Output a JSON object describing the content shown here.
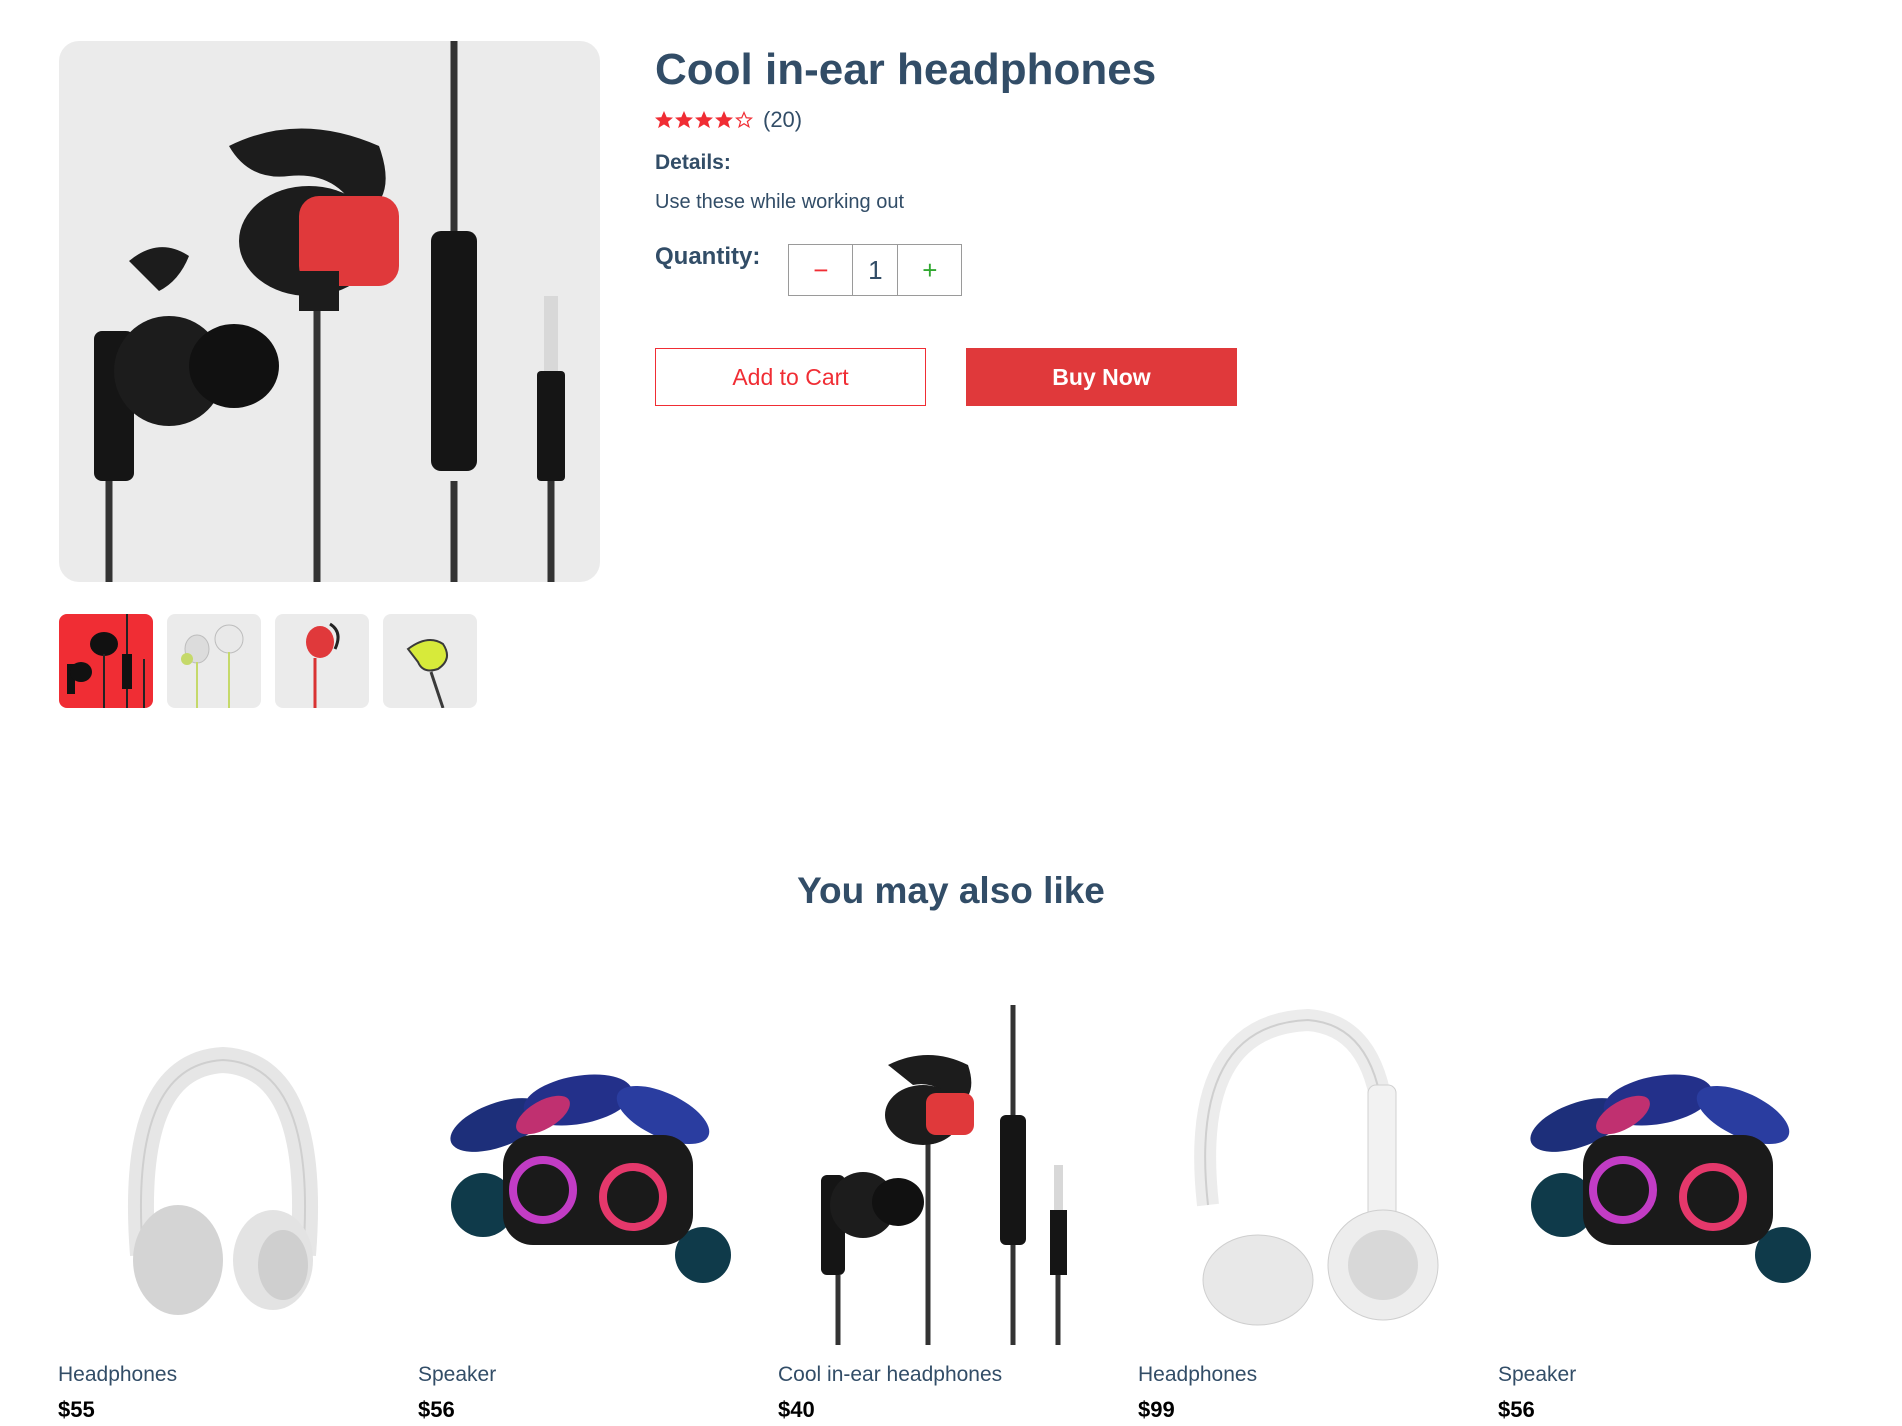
{
  "product": {
    "title": "Cool in-ear headphones",
    "rating": 4,
    "rating_max": 5,
    "review_count": "(20)",
    "details_heading": "Details:",
    "details_text": "Use these while working out",
    "quantity_label": "Quantity:",
    "quantity_value": "1",
    "minus_symbol": "−",
    "plus_symbol": "+",
    "add_to_cart_label": "Add to Cart",
    "buy_now_label": "Buy Now"
  },
  "gallery": {
    "thumbnails": [
      {
        "icon": "red-earphones-thumbnail",
        "selected": true
      },
      {
        "icon": "lime-earphones-thumbnail",
        "selected": false
      },
      {
        "icon": "red-single-earphone-thumbnail",
        "selected": false
      },
      {
        "icon": "yellow-earphone-thumbnail",
        "selected": false
      }
    ]
  },
  "recommendations": {
    "title": "You may also like",
    "items": [
      {
        "name": "Headphones",
        "price": "$55",
        "icon": "white-over-ear-headphones-image"
      },
      {
        "name": "Speaker",
        "price": "$56",
        "icon": "party-speaker-image"
      },
      {
        "name": "Cool in-ear headphones",
        "price": "$40",
        "icon": "in-ear-headphones-image"
      },
      {
        "name": "Headphones",
        "price": "$99",
        "icon": "white-on-ear-headphones-image"
      },
      {
        "name": "Speaker",
        "price": "$56",
        "icon": "party-speaker-image"
      }
    ]
  },
  "colors": {
    "primary_text": "#324d67",
    "accent_red": "#f02d34",
    "buy_red": "#e0393b",
    "plus_green": "#31a831",
    "image_bg": "#ebebeb"
  }
}
